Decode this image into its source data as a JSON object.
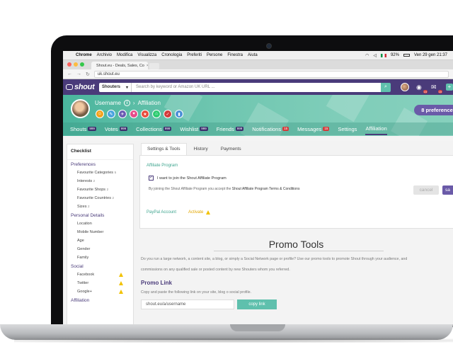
{
  "menubar": {
    "apple": "",
    "items": [
      "Chrome",
      "Archivio",
      "Modifica",
      "Visualizza",
      "Cronologia",
      "Preferiti",
      "Persone",
      "Finestra",
      "Aiuta"
    ],
    "battery": "92%",
    "clock": "Ven 29 gen 21:37"
  },
  "browser": {
    "tab_title": "Shout.eu - Deals, Sales, Co",
    "url": "uk.shout.eu"
  },
  "header": {
    "logo": "shout",
    "search_scope": "Shouters",
    "search_placeholder": "Search by keyword or Amazon UK URL ...",
    "badge_1": "15",
    "badge_2": "15"
  },
  "profile": {
    "username": "Username",
    "breadcrumb": "Affiliation",
    "preferences_label": "8 preferences",
    "badge_icons": [
      "smile-icon",
      "pencil-icon",
      "compass-icon",
      "bag-icon",
      "star-icon",
      "hanger-icon",
      "bulb-icon",
      "chart-icon"
    ],
    "badge_colors": [
      "#f3a21b",
      "#4aa3df",
      "#6b5bb3",
      "#e74c8a",
      "#e74c3c",
      "#2ecc71",
      "#d23b3b",
      "#4a8fd6"
    ]
  },
  "nav": {
    "tabs": [
      {
        "label": "Shouts",
        "count": "999"
      },
      {
        "label": "Votes",
        "count": "999"
      },
      {
        "label": "Collections",
        "count": "999"
      },
      {
        "label": "Wishlist",
        "count": "999"
      },
      {
        "label": "Friends",
        "count": "999"
      },
      {
        "label": "Notifications",
        "count": "15"
      },
      {
        "label": "Messages",
        "count": "15"
      },
      {
        "label": "Settings",
        "count": ""
      },
      {
        "label": "Affiliation",
        "count": ""
      }
    ]
  },
  "sidebar": {
    "title": "Checklist",
    "sections": {
      "preferences": "Preferences",
      "personal": "Personal Details",
      "social": "Social",
      "affiliation": "Affiliation"
    },
    "pref_items": [
      {
        "label": "Favourite Categories",
        "n": "5"
      },
      {
        "label": "Interests",
        "n": "2"
      },
      {
        "label": "Favourite Shops",
        "n": "2"
      },
      {
        "label": "Favourite Countries",
        "n": "2"
      },
      {
        "label": "Sizes",
        "n": "2"
      }
    ],
    "personal_items": [
      "Location",
      "Mobile Number",
      "Age",
      "Gender",
      "Family"
    ],
    "social_items": [
      "Facebook",
      "Twitter",
      "Google+"
    ]
  },
  "main": {
    "subtabs": [
      "Settings & Tools",
      "History",
      "Payments"
    ],
    "affiliate_program": "Affiliate Program",
    "checkbox_label": "I want to join the Shout Affiliate Program",
    "terms_prefix": "By joining the Shout Affiliate Program you accept the",
    "terms_link": "Shout Affiliate Program Terms & Conditions",
    "cancel": "cancel",
    "save": "sa",
    "paypal_label": "PayPal Account",
    "activate_label": "Activate",
    "promo_title": "Promo Tools",
    "promo_desc1": "Do you run a large network, a content site, a blog, or simply a Social Network page or profile? Use our promo tools to promote Shout through your audience, and",
    "promo_desc2": "commissions on any qualified sale or posted content by new Shouters whom you referred.",
    "promo_link_heading": "Promo Link",
    "promo_link_desc": "Copy and paste the following link on your site, blog o social profile.",
    "promo_link_value": "shout.eu/a/username",
    "copy_button": "copy link"
  }
}
